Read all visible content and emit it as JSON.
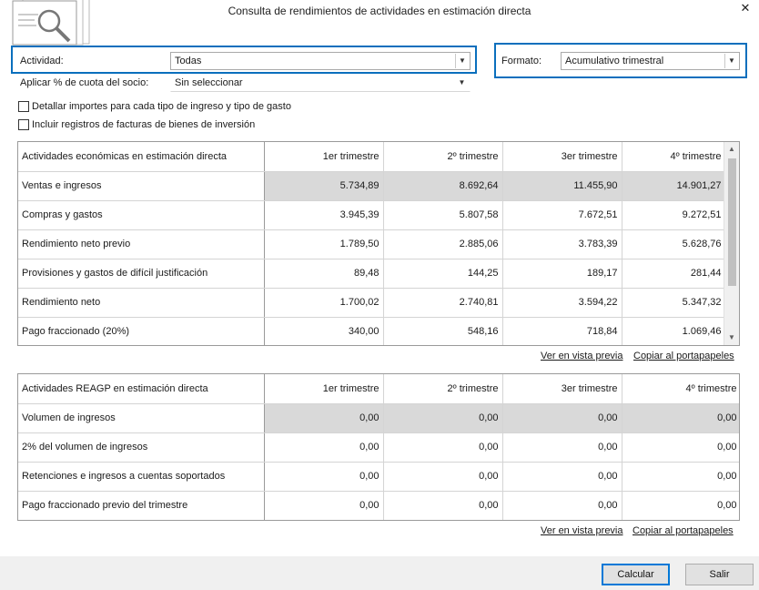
{
  "window": {
    "title": "Consulta de rendimientos de actividades en estimación directa"
  },
  "filters": {
    "actividad_label": "Actividad:",
    "actividad_value": "Todas",
    "formato_label": "Formato:",
    "formato_value": "Acumulativo trimestral",
    "cuota_label": "Aplicar % de cuota del socio:",
    "cuota_value": "Sin seleccionar"
  },
  "options": {
    "detallar": {
      "label": "Detallar importes para cada tipo de ingreso y tipo de gasto",
      "checked": false
    },
    "incluir": {
      "label": "Incluir registros de facturas de bienes de inversión",
      "checked": false
    }
  },
  "table1": {
    "headers": [
      "Actividades económicas en estimación directa",
      "1er trimestre",
      "2º trimestre",
      "3er trimestre",
      "4º trimestre"
    ],
    "rows": [
      [
        "Ventas e ingresos",
        "5.734,89",
        "8.692,64",
        "11.455,90",
        "14.901,27"
      ],
      [
        "Compras y gastos",
        "3.945,39",
        "5.807,58",
        "7.672,51",
        "9.272,51"
      ],
      [
        "Rendimiento neto previo",
        "1.789,50",
        "2.885,06",
        "3.783,39",
        "5.628,76"
      ],
      [
        "Provisiones y gastos de difícil justificación",
        "89,48",
        "144,25",
        "189,17",
        "281,44"
      ],
      [
        "Rendimiento neto",
        "1.700,02",
        "2.740,81",
        "3.594,22",
        "5.347,32"
      ],
      [
        "Pago fraccionado (20%)",
        "340,00",
        "548,16",
        "718,84",
        "1.069,46"
      ]
    ],
    "link_preview": "Ver en vista previa",
    "link_copy": "Copiar al portapapeles"
  },
  "table2": {
    "headers": [
      "Actividades REAGP en estimación directa",
      "1er trimestre",
      "2º trimestre",
      "3er trimestre",
      "4º trimestre"
    ],
    "rows": [
      [
        "Volumen de ingresos",
        "0,00",
        "0,00",
        "0,00",
        "0,00"
      ],
      [
        "2% del volumen de ingresos",
        "0,00",
        "0,00",
        "0,00",
        "0,00"
      ],
      [
        "Retenciones e ingresos a cuentas soportados",
        "0,00",
        "0,00",
        "0,00",
        "0,00"
      ],
      [
        "Pago fraccionado previo del trimestre",
        "0,00",
        "0,00",
        "0,00",
        "0,00"
      ]
    ],
    "link_preview": "Ver en vista previa",
    "link_copy": "Copiar al portapapeles"
  },
  "buttons": {
    "calcular": "Calcular",
    "salir": "Salir"
  },
  "icons": {
    "close": "close-icon",
    "logo": "report-magnifier-icon",
    "dropdown": "chevron-down-icon"
  },
  "colors": {
    "accent": "#0a6fbd",
    "highlight_row": "#d9d9d9",
    "footer": "#f0f0f0"
  }
}
